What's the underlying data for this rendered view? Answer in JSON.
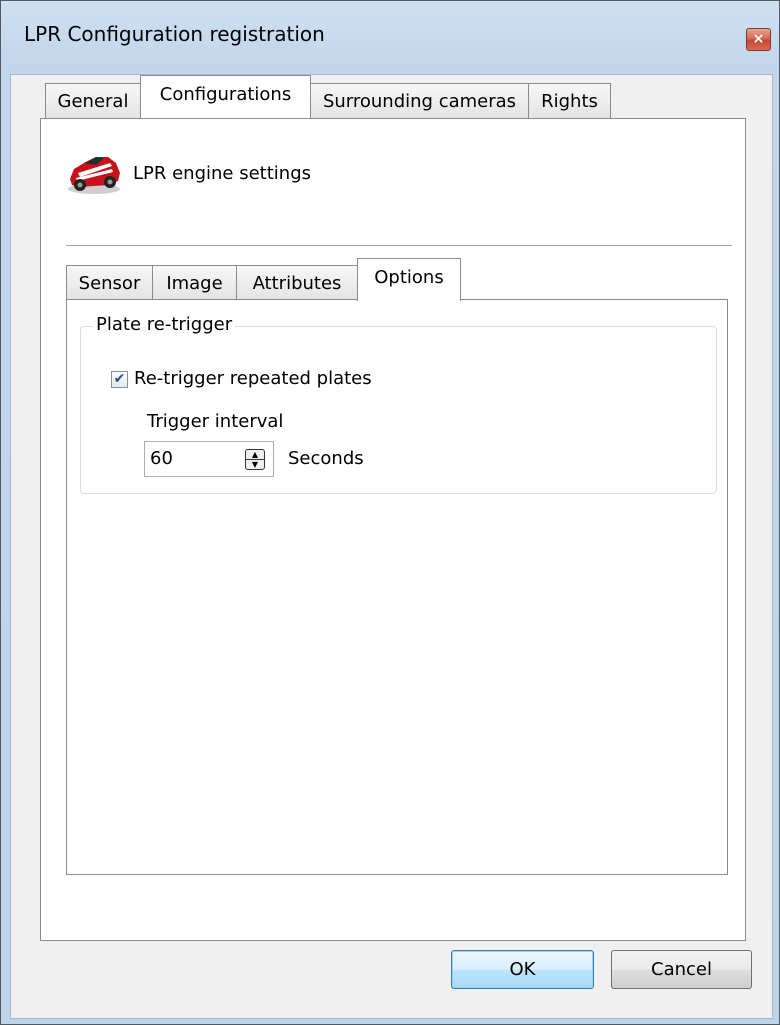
{
  "window": {
    "title": "LPR Configuration registration",
    "close_glyph": "×"
  },
  "tabs": [
    {
      "label": "General",
      "active": false
    },
    {
      "label": "Configurations",
      "active": true
    },
    {
      "label": "Surrounding cameras",
      "active": false
    },
    {
      "label": "Rights",
      "active": false
    }
  ],
  "engine": {
    "icon": "car-icon",
    "label": "LPR engine settings"
  },
  "subtabs": [
    {
      "label": "Sensor",
      "active": false
    },
    {
      "label": "Image",
      "active": false
    },
    {
      "label": "Attributes",
      "active": false
    },
    {
      "label": "Options",
      "active": true
    }
  ],
  "plate_retrigger": {
    "legend": "Plate re-trigger",
    "checkbox_label": "Re-trigger repeated plates",
    "checked": true,
    "interval_label": "Trigger interval",
    "interval_value": "60",
    "unit": "Seconds"
  },
  "buttons": {
    "ok": "OK",
    "cancel": "Cancel"
  },
  "colors": {
    "title_bar": "#c2d7ec",
    "close_button": "#c24734",
    "default_button": "#bee6fd"
  }
}
